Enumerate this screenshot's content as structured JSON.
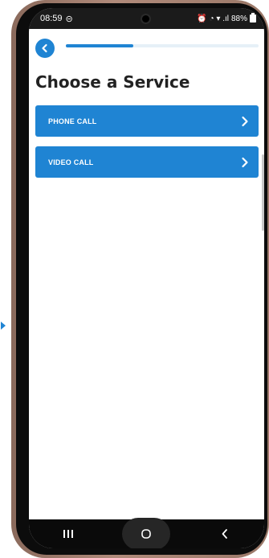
{
  "status_bar": {
    "time": "08:59",
    "status_icons": "🔔 ≡ ⚲ ↑↓ .ill",
    "battery": "88%"
  },
  "header": {
    "back_icon": "chevron-left-icon",
    "progress_fraction": 0.35
  },
  "page": {
    "title": "Choose a Service"
  },
  "services": [
    {
      "label": "PHONE CALL"
    },
    {
      "label": "VIDEO CALL"
    }
  ],
  "colors": {
    "accent": "#1f84d3",
    "text": "#222222"
  }
}
